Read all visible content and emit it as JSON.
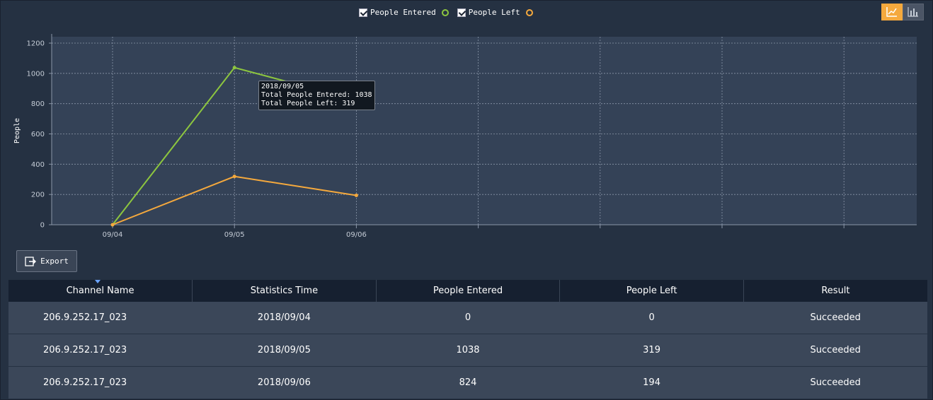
{
  "legend": [
    {
      "label": "People Entered",
      "color": "#8dc63f",
      "checked": true
    },
    {
      "label": "People Left",
      "color": "#f5a93d",
      "checked": true
    }
  ],
  "view_switch": {
    "active": "line-chart-icon",
    "inactive": "bar-chart-icon",
    "active_color": "#f5a93d"
  },
  "chart_data": {
    "type": "line",
    "ylabel": "People",
    "xlabel": "",
    "ylim": [
      0,
      1200
    ],
    "yticks": [
      0,
      200,
      400,
      600,
      800,
      1000,
      1200
    ],
    "x_slots": [
      "09/04",
      "09/05",
      "09/06",
      "",
      "",
      "",
      ""
    ],
    "grid": true,
    "series": [
      {
        "name": "People Entered",
        "color": "#8dc63f",
        "values": [
          0,
          1038,
          824
        ]
      },
      {
        "name": "People Left",
        "color": "#f5a93d",
        "values": [
          0,
          319,
          194
        ]
      }
    ],
    "tooltip": {
      "date": "2018/09/05",
      "line1": "Total People Entered: 1038",
      "line2": "Total People Left: 319"
    }
  },
  "export": {
    "label": "Export"
  },
  "table": {
    "columns": [
      "Channel Name",
      "Statistics Time",
      "People Entered",
      "People Left",
      "Result"
    ],
    "rows": [
      [
        "206.9.252.17_023",
        "2018/09/04",
        "0",
        "0",
        "Succeeded"
      ],
      [
        "206.9.252.17_023",
        "2018/09/05",
        "1038",
        "319",
        "Succeeded"
      ],
      [
        "206.9.252.17_023",
        "2018/09/06",
        "824",
        "194",
        "Succeeded"
      ]
    ]
  }
}
